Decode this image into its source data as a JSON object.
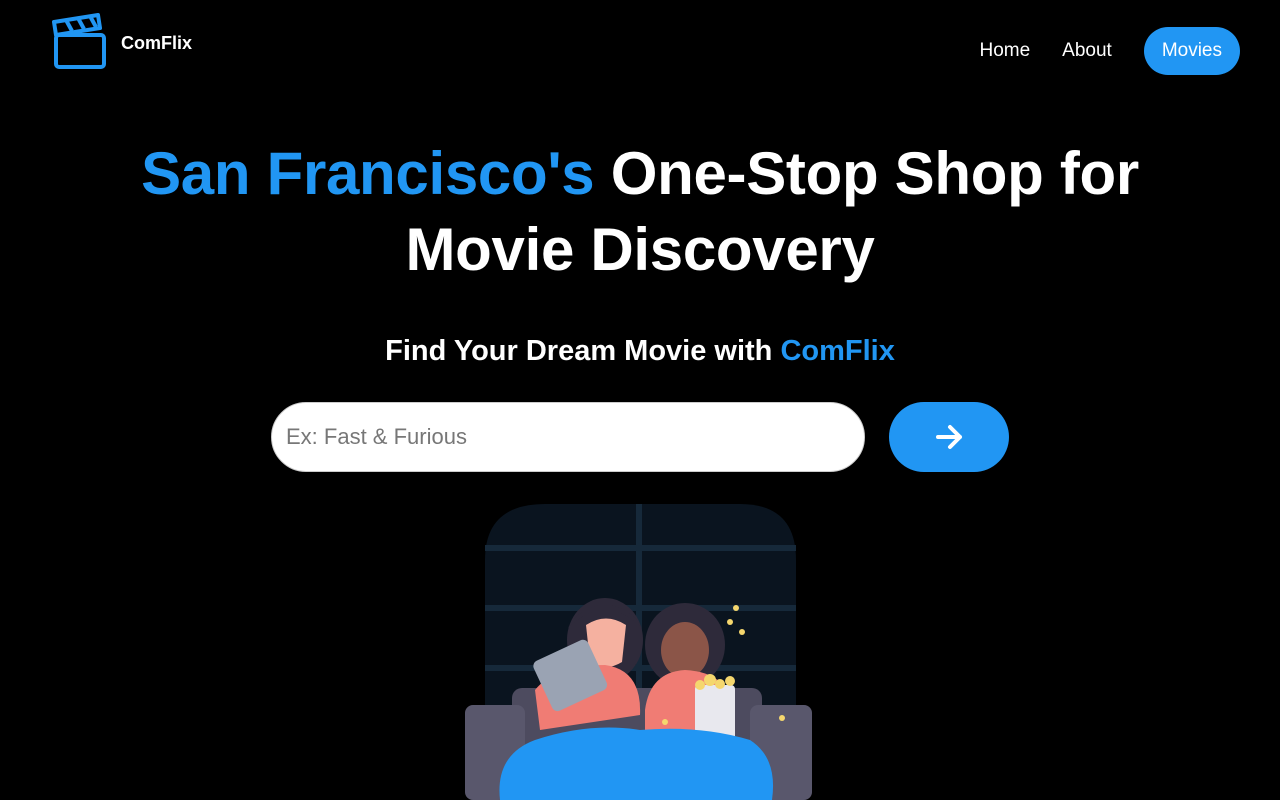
{
  "header": {
    "brand": "ComFlix",
    "logo_icon": "clapperboard-icon",
    "nav": {
      "home": "Home",
      "about": "About",
      "movies": "Movies"
    }
  },
  "hero": {
    "title_accent": "San Francisco's",
    "title_rest": " One-Stop Shop for",
    "title_line2": "Movie Discovery",
    "subtitle_prefix": "Find Your Dream Movie with ",
    "subtitle_accent": "ComFlix"
  },
  "search": {
    "placeholder": "Ex: Fast & Furious",
    "value": "",
    "button_icon": "arrow-right-icon"
  },
  "illustration": {
    "icon": "movie-watching-illustration"
  },
  "colors": {
    "accent": "#2196f3",
    "background": "#000000",
    "text": "#ffffff"
  }
}
